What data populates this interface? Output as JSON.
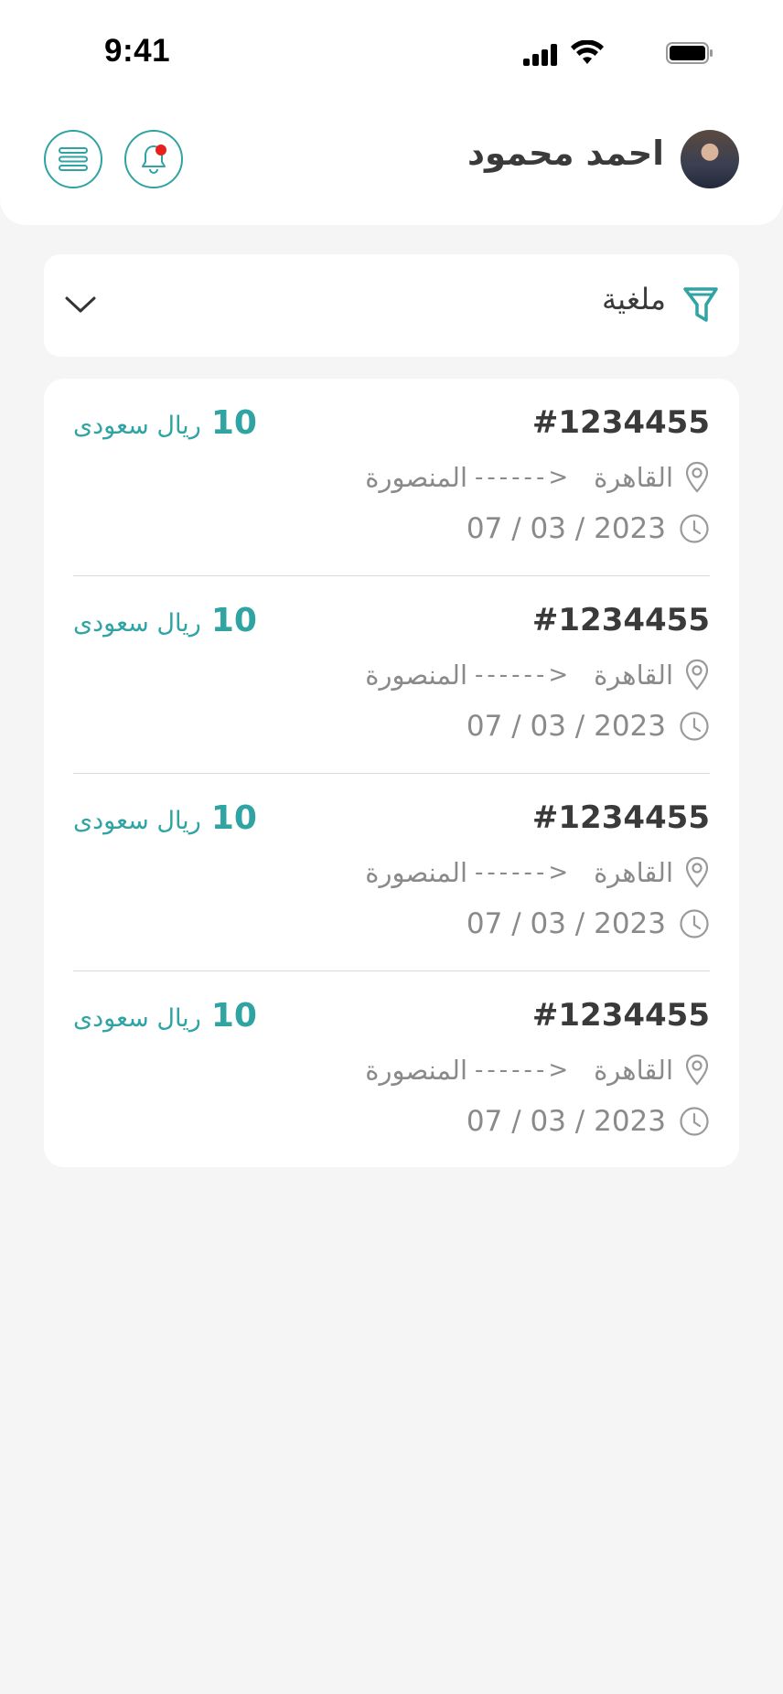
{
  "status_bar": {
    "time": "9:41"
  },
  "header": {
    "user_name": "احمد محمود",
    "icons": {
      "menu": "menu-icon",
      "notifications": "bell-icon",
      "avatar": "user-avatar"
    }
  },
  "filter": {
    "selected": "ملغية",
    "icon": "filter-funnel-icon",
    "dropdown_icon": "chevron-down-icon"
  },
  "orders": [
    {
      "id": "#1234455",
      "from": "القاهرة",
      "arrow": "------>",
      "to": "المنصورة",
      "date": "07 / 03 / 2023",
      "price": "10",
      "currency": "ريال سعودى"
    },
    {
      "id": "#1234455",
      "from": "القاهرة",
      "arrow": "------>",
      "to": "المنصورة",
      "date": "07 / 03 / 2023",
      "price": "10",
      "currency": "ريال سعودى"
    },
    {
      "id": "#1234455",
      "from": "القاهرة",
      "arrow": "------>",
      "to": "المنصورة",
      "date": "07 / 03 / 2023",
      "price": "10",
      "currency": "ريال سعودى"
    },
    {
      "id": "#1234455",
      "from": "القاهرة",
      "arrow": "------>",
      "to": "المنصورة",
      "date": "07 / 03 / 2023",
      "price": "10",
      "currency": "ريال سعودى"
    }
  ],
  "colors": {
    "accent": "#30a3a3",
    "notification_dot": "#e8201d",
    "background": "#f5f5f5",
    "text_dark": "#3a3a3a",
    "text_muted": "#8a8a8a"
  }
}
